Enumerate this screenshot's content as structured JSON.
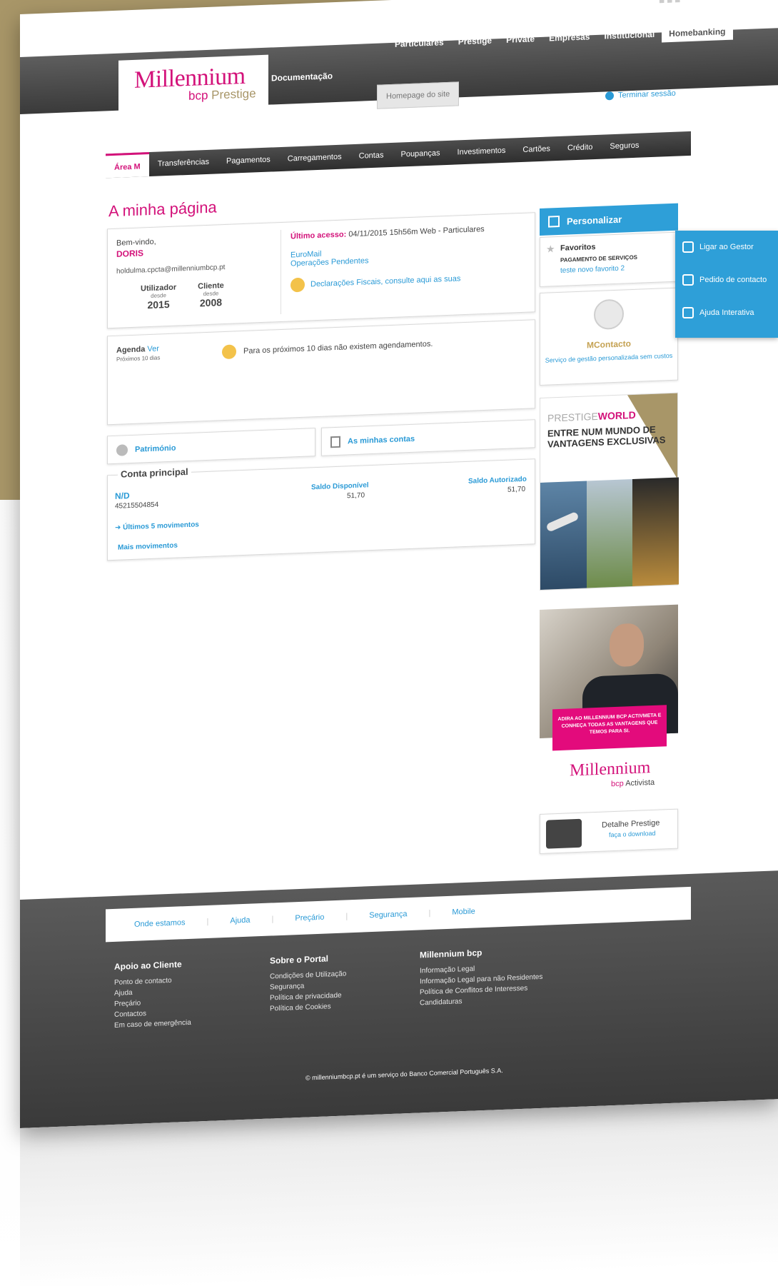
{
  "top": {
    "tabs": [
      "Particulares",
      "Prestige",
      "Private",
      "Empresas",
      "Institucional",
      "Homebanking"
    ],
    "documentacao": "Documentação",
    "homepage": "Homepage do site",
    "logout": "Terminar sessão"
  },
  "logo": {
    "main": "Millennium",
    "bcp": "bcp",
    "prestige": "Prestige"
  },
  "nav": [
    "Área M",
    "Transferências",
    "Pagamentos",
    "Carregamentos",
    "Contas",
    "Poupanças",
    "Investimentos",
    "Cartões",
    "Crédito",
    "Seguros"
  ],
  "page": {
    "title": "A minha página"
  },
  "welcome": {
    "greeting": "Bem-vindo,",
    "name": "DORIS",
    "email": "holdulma.cpcta@millenniumbcp.pt",
    "utilizador_label": "Utilizador",
    "cliente_label": "Cliente",
    "desde": "desde",
    "utilizador_year": "2015",
    "cliente_year": "2008",
    "last_access_label": "Último acesso:",
    "last_access_value": "04/11/2015 15h56m Web - Particulares",
    "link1": "EuroMail",
    "link2": "Operações Pendentes",
    "fiscal": "Declarações Fiscais, consulte aqui as suas"
  },
  "agenda": {
    "title": "Agenda",
    "ver": "Ver",
    "sub": "Próximos 10 dias",
    "msg": "Para os próximos 10 dias não existem agendamentos."
  },
  "buttons": {
    "patrimonio": "Património",
    "contas": "As minhas contas"
  },
  "conta": {
    "legend": "Conta principal",
    "nd": "N/D",
    "account": "45215504854",
    "saldo_disp_label": "Saldo Disponível",
    "saldo_disp": "51,70",
    "saldo_aut_label": "Saldo Autorizado",
    "saldo_aut": "51,70",
    "movimentos": "Últimos 5 movimentos",
    "mais": "Mais movimentos"
  },
  "sidebar": {
    "personalizar": "Personalizar",
    "favoritos": "Favoritos",
    "fav_a": "PAGAMENTO DE SERVIÇOS",
    "fav_b": "teste novo favorito 2",
    "mcontacto": "MContacto",
    "mcontacto_desc": "Serviço de gestão personalizada sem custos",
    "prestige_word": "PRESTIGE",
    "world_word": "WORLD",
    "tagline": "ENTRE NUM MUNDO DE VANTAGENS EXCLUSIVAS",
    "activa_box": "ADIRA AO MILLENNIUM BCP ACTIVMETA E CONHEÇA TODAS AS VANTAGENS QUE TEMOS PARA SI.",
    "activa_logo": "Millennium",
    "activa_bcp": "bcp",
    "activa_word": "Activista",
    "detalhe_title": "Detalhe Prestige",
    "detalhe_sub": "faça o download"
  },
  "popout": [
    "Ligar ao Gestor",
    "Pedido de contacto",
    "Ajuda Interativa"
  ],
  "footer": {
    "links": [
      "Onde estamos",
      "Ajuda",
      "Preçário",
      "Segurança",
      "Mobile"
    ],
    "col1": {
      "title": "Apoio ao Cliente",
      "items": [
        "Ponto de contacto",
        "Ajuda",
        "Preçário",
        "Contactos",
        "Em caso de emergência"
      ]
    },
    "col2": {
      "title": "Sobre o Portal",
      "items": [
        "Condições de Utilização",
        "Segurança",
        "Política de privacidade",
        "Política de Cookies"
      ]
    },
    "col3": {
      "title": "Millennium bcp",
      "items": [
        "Informação Legal",
        "Informação Legal para não Residentes",
        "Política de Conflitos de Interesses",
        "Candidaturas"
      ]
    },
    "copyright": "© millenniumbcp.pt é um serviço do Banco Comercial Português S.A."
  }
}
